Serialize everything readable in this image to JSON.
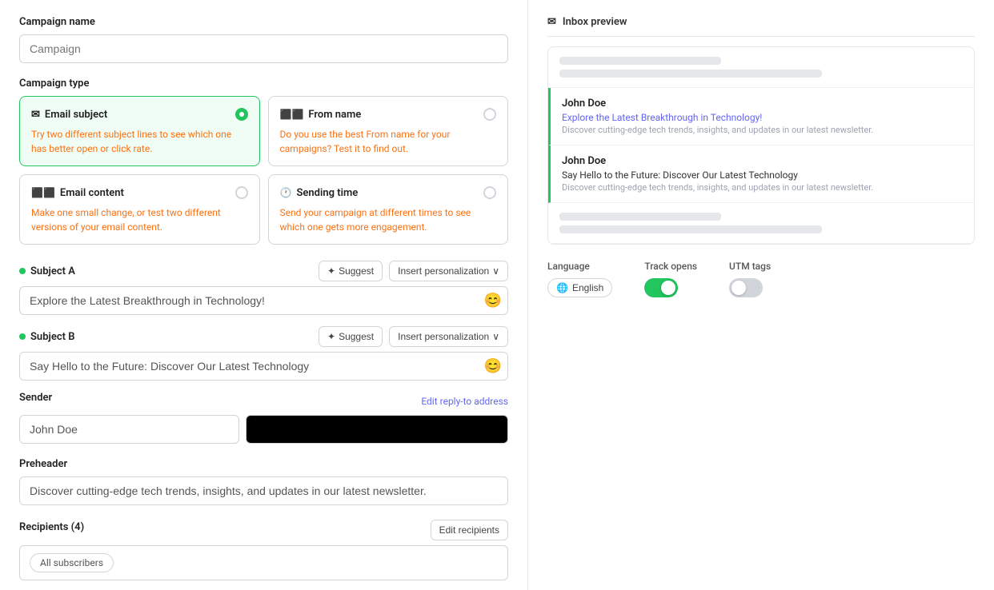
{
  "left": {
    "campaign_name_label": "Campaign name",
    "campaign_name_placeholder": "Campaign",
    "campaign_type_label": "Campaign type",
    "type_cards": [
      {
        "id": "email_subject",
        "icon": "mail",
        "title": "Email subject",
        "desc": "Try two different subject lines to see which one has better open or click rate.",
        "selected": true
      },
      {
        "id": "from_name",
        "icon": "people",
        "title": "From name",
        "desc": "Do you use the best From name for your campaigns? Test it to find out.",
        "selected": false
      },
      {
        "id": "email_content",
        "icon": "file",
        "title": "Email content",
        "desc": "Make one small change, or test two different versions of your email content.",
        "selected": false
      },
      {
        "id": "sending_time",
        "icon": "clock",
        "title": "Sending time",
        "desc": "Send your campaign at different times to see which one gets more engagement.",
        "selected": false
      }
    ],
    "subject_a_label": "Subject A",
    "subject_b_label": "Subject B",
    "suggest_label": "Suggest",
    "insert_personalization_label": "Insert personalization",
    "subject_a_value": "Explore the Latest Breakthrough in Technology!",
    "subject_b_value": "Say Hello to the Future: Discover Our Latest Technology",
    "sender_label": "Sender",
    "edit_reply_label": "Edit reply-to address",
    "sender_name_value": "John Doe",
    "sender_email_value": "",
    "preheader_label": "Preheader",
    "preheader_value": "Discover cutting-edge tech trends, insights, and updates in our latest newsletter.",
    "recipients_label": "Recipients (4)",
    "edit_recipients_label": "Edit recipients",
    "recipients_tag": "All subscribers"
  },
  "right": {
    "inbox_preview_label": "Inbox preview",
    "email_rows": [
      {
        "sender": "John Doe",
        "subject": "Explore the Latest Breakthrough in Technology!",
        "preheader": "Discover cutting-edge tech trends, insights, and updates in our latest newsletter.",
        "highlighted": true,
        "subject_colored": true
      },
      {
        "sender": "John Doe",
        "subject": "Say Hello to the Future: Discover Our Latest Technology",
        "preheader": "Discover cutting-edge tech trends, insights, and updates in our latest newsletter.",
        "highlighted": true,
        "subject_colored": false
      }
    ],
    "language_label": "Language",
    "language_value": "English",
    "track_opens_label": "Track opens",
    "track_opens_enabled": true,
    "utm_tags_label": "UTM tags",
    "utm_tags_enabled": false
  },
  "icons": {
    "mail": "✉",
    "people": "⬛⬛",
    "file": "📄",
    "clock": "🕐",
    "globe": "🌐",
    "chevron_down": "∨",
    "sparkle": "✦"
  }
}
